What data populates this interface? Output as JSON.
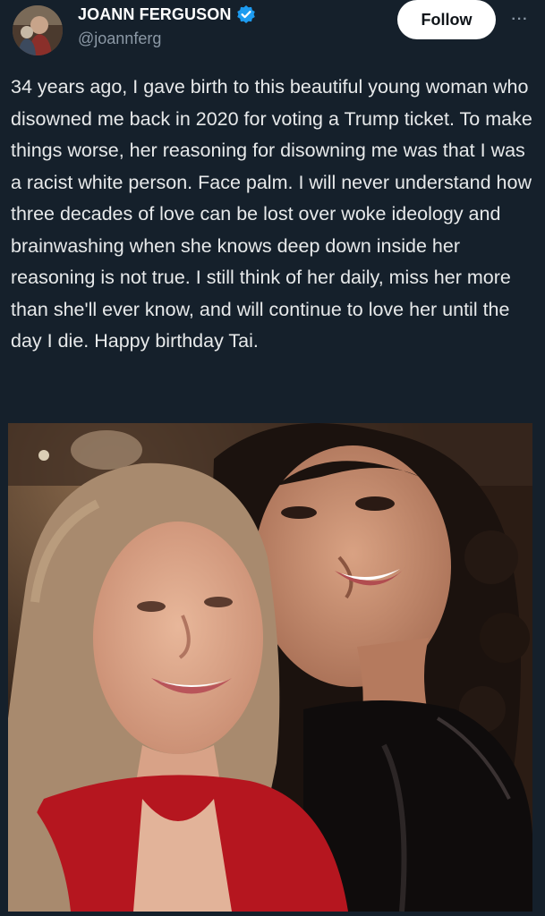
{
  "post": {
    "author": {
      "display_name": "JOANN FERGUSON",
      "handle": "@joannferg",
      "verified": true,
      "avatar_icon": "avatar-photo",
      "verified_icon": "verified-badge-icon"
    },
    "follow_label": "Follow",
    "more_icon": "more-options-icon",
    "more_glyph": "···",
    "text": "34 years ago, I gave birth to this beautiful young woman who disowned me back in 2020 for voting a Trump ticket. To make things worse, her reasoning for disowning me was that I was a racist white person. Face palm. I will never understand how three decades of love can be lost over woke ideology and brainwashing when she knows deep down inside her reasoning is not true. I still think of her daily, miss her more than she'll ever know, and will continue to love her until the day I die. Happy birthday Tai.",
    "media": {
      "type": "photo",
      "icon": "photo-two-women-selfie"
    }
  },
  "colors": {
    "background": "#15202b",
    "text": "#e7e9ea",
    "secondary": "#8b98a5",
    "verified": "#1d9bf0",
    "button_bg": "#ffffff"
  }
}
